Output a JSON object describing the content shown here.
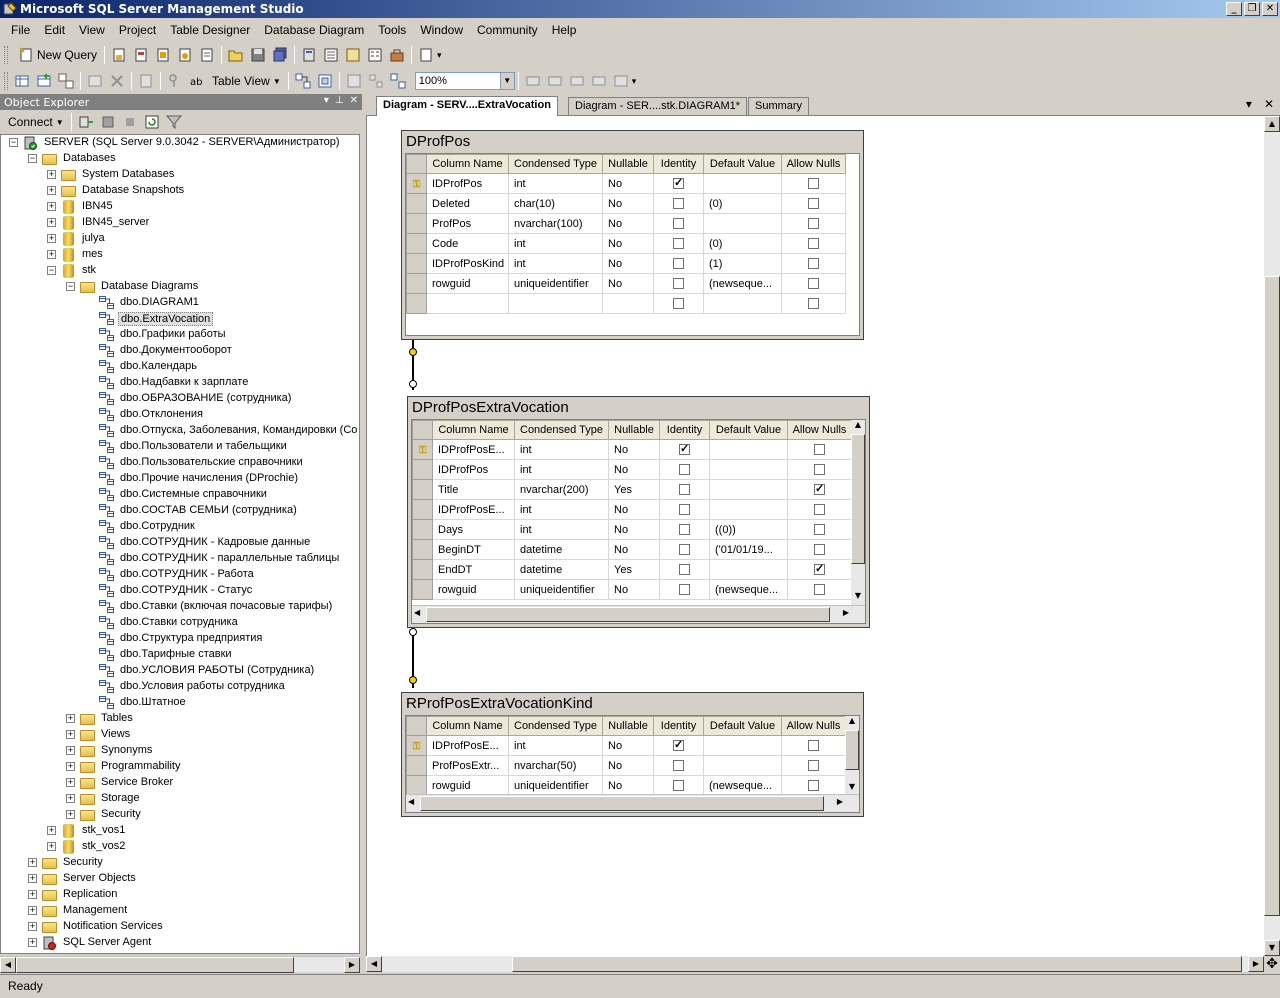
{
  "window": {
    "title": "Microsoft SQL Server Management Studio"
  },
  "menubar": [
    "File",
    "Edit",
    "View",
    "Project",
    "Table Designer",
    "Database Diagram",
    "Tools",
    "Window",
    "Community",
    "Help"
  ],
  "toolbar1": {
    "new_query": "New Query"
  },
  "toolbar2": {
    "table_view": "Table View",
    "zoom": "100%"
  },
  "object_explorer": {
    "title": "Object Explorer",
    "connect_label": "Connect",
    "server": "SERVER (SQL Server 9.0.3042 - SERVER\\Администратор)",
    "databases": "Databases",
    "system_databases": "System Databases",
    "database_snapshots": "Database Snapshots",
    "db_ibn45": "IBN45",
    "db_ibn45_server": "IBN45_server",
    "db_julya": "julya",
    "db_mes": "mes",
    "db_stk": "stk",
    "database_diagrams": "Database Diagrams",
    "diagrams": [
      "dbo.DIAGRAM1",
      "dbo.ExtraVocation",
      "dbo.Графики работы",
      "dbo.Документооборот",
      "dbo.Календарь",
      "dbo.Надбавки к зарплате",
      "dbo.ОБРАЗОВАНИЕ (сотрудника)",
      "dbo.Отклонения",
      "dbo.Отпуска, Заболевания, Командировки (Со",
      "dbo.Пользователи и табельщики",
      "dbo.Пользовательские справочники",
      "dbo.Прочие начисления (DProchie)",
      "dbo.Системные справочники",
      "dbo.СОСТАВ СЕМЬИ (сотрудника)",
      "dbo.Сотрудник",
      "dbo.СОТРУДНИК - Кадровые данные",
      "dbo.СОТРУДНИК - параллельные таблицы",
      "dbo.СОТРУДНИК - Работа",
      "dbo.СОТРУДНИК - Статус",
      "dbo.Ставки (включая почасовые тарифы)",
      "dbo.Ставки сотрудника",
      "dbo.Структура предприятия",
      "dbo.Тарифные ставки",
      "dbo.УСЛОВИЯ РАБОТЫ (Сотрудника)",
      "dbo.Условия работы сотрудника",
      "dbo.Штатное"
    ],
    "stk_children": [
      "Tables",
      "Views",
      "Synonyms",
      "Programmability",
      "Service Broker",
      "Storage",
      "Security"
    ],
    "db_stk_vos1": "stk_vos1",
    "db_stk_vos2": "stk_vos2",
    "server_children": [
      "Security",
      "Server Objects",
      "Replication",
      "Management",
      "Notification Services",
      "SQL Server Agent"
    ]
  },
  "tabs": [
    "Diagram - SERV....ExtraVocation",
    "Diagram - SER....stk.DIAGRAM1*",
    "Summary"
  ],
  "columns_header": [
    "Column Name",
    "Condensed Type",
    "Nullable",
    "Identity",
    "Default Value",
    "Allow Nulls"
  ],
  "tables": {
    "t1": {
      "name": "DProfPos",
      "rows": [
        {
          "name": "IDProfPos",
          "type": "int",
          "nullable": "No",
          "identity": true,
          "default": "",
          "allow": false,
          "key": true
        },
        {
          "name": "Deleted",
          "type": "char(10)",
          "nullable": "No",
          "identity": false,
          "default": "(0)",
          "allow": false
        },
        {
          "name": "ProfPos",
          "type": "nvarchar(100)",
          "nullable": "No",
          "identity": false,
          "default": "",
          "allow": false
        },
        {
          "name": "Code",
          "type": "int",
          "nullable": "No",
          "identity": false,
          "default": "(0)",
          "allow": false
        },
        {
          "name": "IDProfPosKind",
          "type": "int",
          "nullable": "No",
          "identity": false,
          "default": "(1)",
          "allow": false
        },
        {
          "name": "rowguid",
          "type": "uniqueidentifier",
          "nullable": "No",
          "identity": false,
          "default": "(newseque...",
          "allow": false
        },
        {
          "name": "",
          "type": "",
          "nullable": "",
          "identity": false,
          "default": "",
          "allow": false
        }
      ]
    },
    "t2": {
      "name": "DProfPosExtraVocation",
      "rows": [
        {
          "name": "IDProfPosE...",
          "type": "int",
          "nullable": "No",
          "identity": true,
          "default": "",
          "allow": false,
          "key": true
        },
        {
          "name": "IDProfPos",
          "type": "int",
          "nullable": "No",
          "identity": false,
          "default": "",
          "allow": false
        },
        {
          "name": "Title",
          "type": "nvarchar(200)",
          "nullable": "Yes",
          "identity": false,
          "default": "",
          "allow": true
        },
        {
          "name": "IDProfPosE...",
          "type": "int",
          "nullable": "No",
          "identity": false,
          "default": "",
          "allow": false
        },
        {
          "name": "Days",
          "type": "int",
          "nullable": "No",
          "identity": false,
          "default": "((0))",
          "allow": false
        },
        {
          "name": "BeginDT",
          "type": "datetime",
          "nullable": "No",
          "identity": false,
          "default": "('01/01/19...",
          "allow": false
        },
        {
          "name": "EndDT",
          "type": "datetime",
          "nullable": "Yes",
          "identity": false,
          "default": "",
          "allow": true
        },
        {
          "name": "rowguid",
          "type": "uniqueidentifier",
          "nullable": "No",
          "identity": false,
          "default": "(newseque...",
          "allow": false
        }
      ]
    },
    "t3": {
      "name": "RProfPosExtraVocationKind",
      "rows": [
        {
          "name": "IDProfPosE...",
          "type": "int",
          "nullable": "No",
          "identity": true,
          "default": "",
          "allow": false,
          "key": true
        },
        {
          "name": "ProfPosExtr...",
          "type": "nvarchar(50)",
          "nullable": "No",
          "identity": false,
          "default": "",
          "allow": false
        },
        {
          "name": "rowguid",
          "type": "uniqueidentifier",
          "nullable": "No",
          "identity": false,
          "default": "(newseque...",
          "allow": false
        }
      ]
    }
  },
  "statusbar": {
    "text": "Ready"
  }
}
